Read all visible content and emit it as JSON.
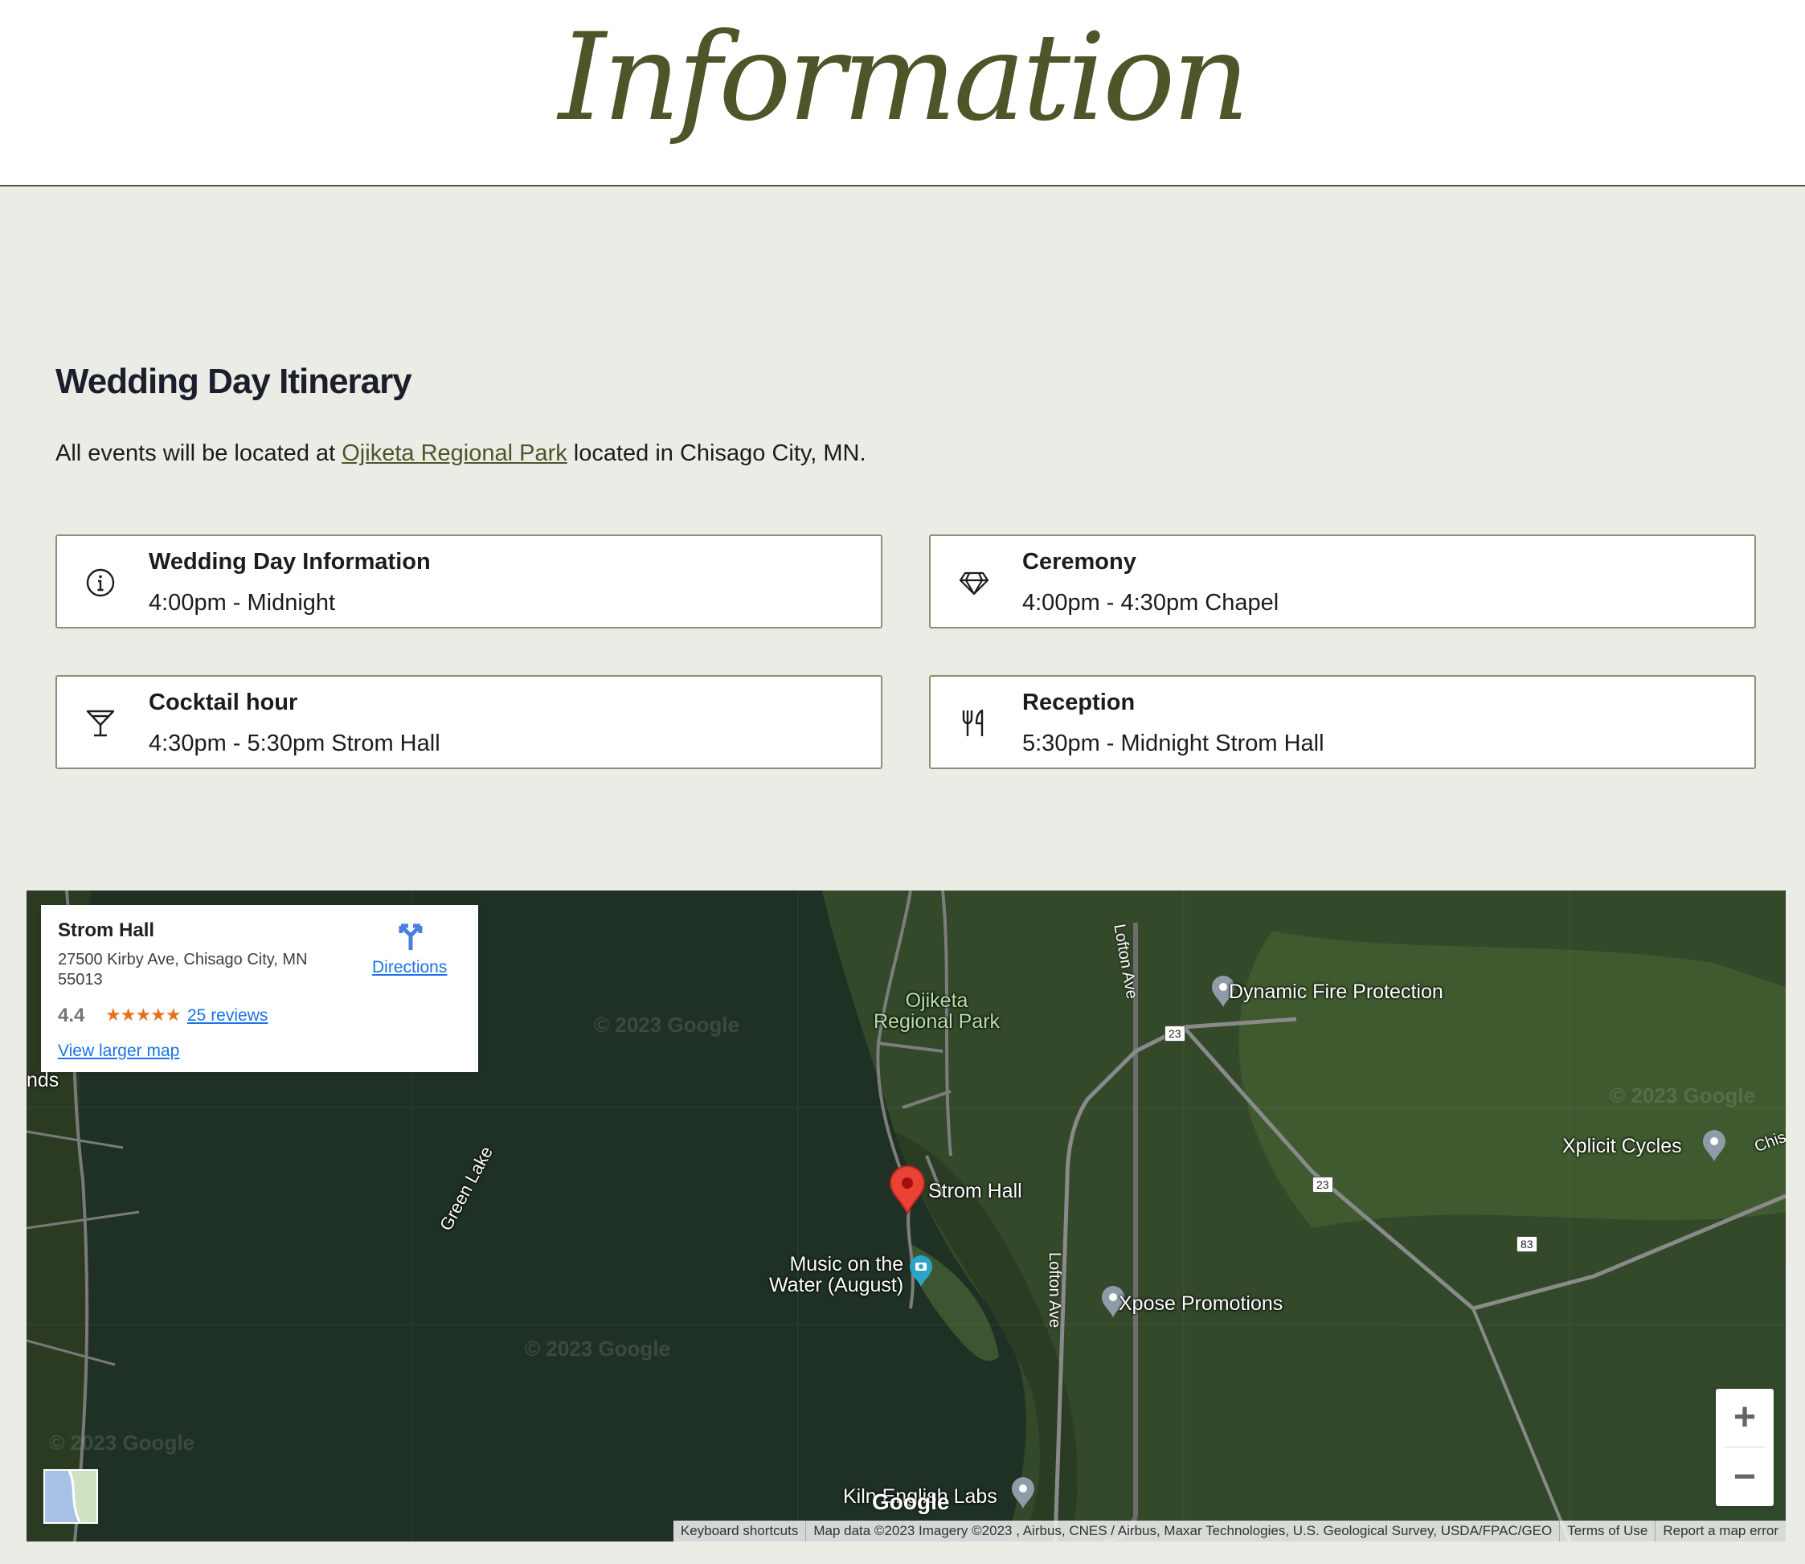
{
  "header": {
    "title": "Information"
  },
  "section": {
    "heading": "Wedding Day Itinerary",
    "intro_before": "All events will be located at ",
    "intro_link": "Ojiketa Regional Park",
    "intro_after": " located in Chisago City, MN."
  },
  "cards": [
    {
      "title": "Wedding Day Information",
      "time": "4:00pm - Midnight",
      "icon": "info-circle-icon"
    },
    {
      "title": "Ceremony",
      "time": "4:00pm - 4:30pm Chapel",
      "icon": "diamond-icon"
    },
    {
      "title": "Cocktail hour",
      "time": "4:30pm - 5:30pm Strom Hall",
      "icon": "cocktail-glass-icon"
    },
    {
      "title": "Reception",
      "time": "5:30pm - Midnight Strom Hall",
      "icon": "fork-knife-icon"
    }
  ],
  "map": {
    "place": {
      "name": "Strom Hall",
      "address": "27500 Kirby Ave, Chisago City, MN 55013",
      "rating": "4.4",
      "stars": "★★★★★",
      "reviews": "25 reviews",
      "directions": "Directions",
      "view_larger": "View larger map"
    },
    "labels": {
      "park": "Ojiketa\nRegional Park",
      "strom_hall": "Strom Hall",
      "music": "Music on the\nWater (August)",
      "dynamic_fire": "Dynamic Fire Protection",
      "xplicit": "Xplicit Cycles",
      "xpose": "Xpose Promotions",
      "kiln": "Kiln English Labs",
      "green_lake": "Green Lake",
      "lofton_top": "Lofton Ave",
      "lofton_mid": "Lofton Ave",
      "edge_left": "nds",
      "edge_right": "Chis",
      "hwy23a": "23",
      "hwy23b": "23",
      "hwy83": "83",
      "watermark": "© 2023 Google",
      "google": "Google"
    },
    "zoom_in": "+",
    "zoom_out": "−",
    "footer": {
      "shortcuts": "Keyboard shortcuts",
      "data": "Map data ©2023 Imagery ©2023 , Airbus, CNES / Airbus, Maxar Technologies, U.S. Geological Survey, USDA/FPAC/GEO",
      "terms": "Terms of Use",
      "report": "Report a map error"
    }
  }
}
